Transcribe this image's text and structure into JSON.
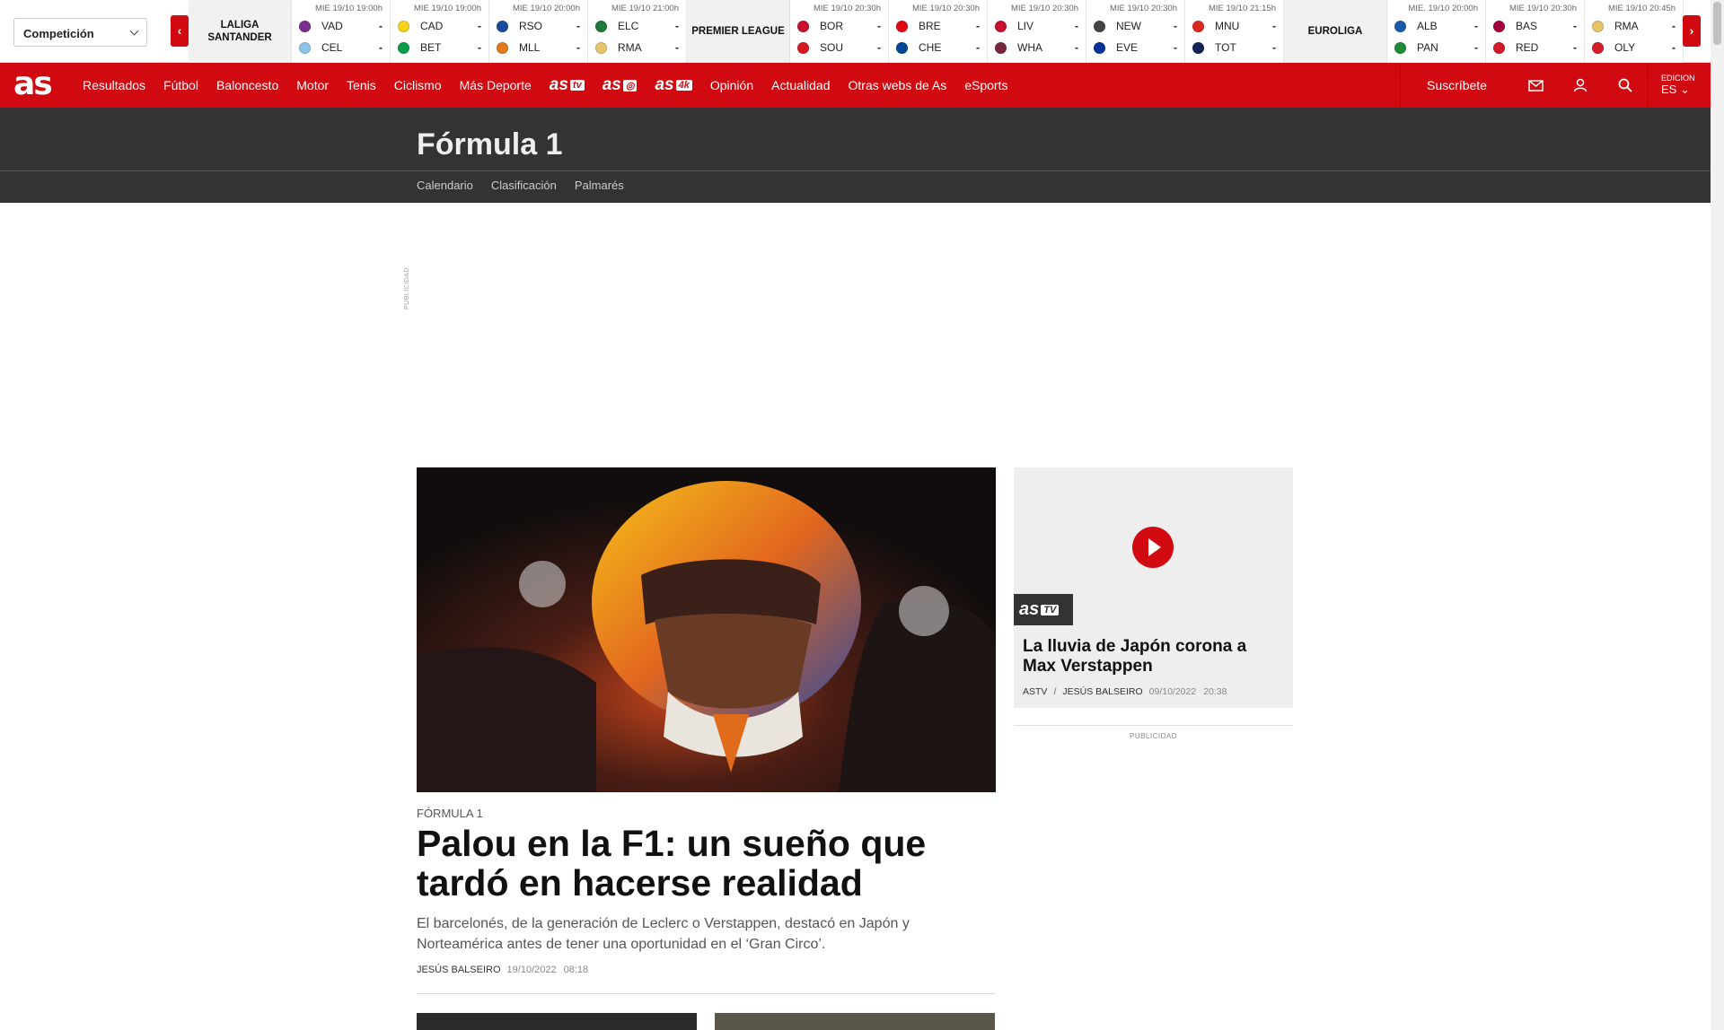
{
  "scores": {
    "competition_select": "Competición",
    "groups": [
      {
        "league": "LALIGA SANTANDER",
        "matches": [
          {
            "time": "MIE 19/10 19:00h",
            "home": "VAD",
            "away": "CEL",
            "home_score": "-",
            "away_score": "-",
            "home_color": "#7a2e8f",
            "away_color": "#8ec4e8"
          },
          {
            "time": "MIE 19/10 19:00h",
            "home": "CAD",
            "away": "BET",
            "home_score": "-",
            "away_score": "-",
            "home_color": "#f2d21b",
            "away_color": "#0a9c4a"
          },
          {
            "time": "MIE 19/10 20:00h",
            "home": "RSO",
            "away": "MLL",
            "home_score": "-",
            "away_score": "-",
            "home_color": "#1a4a9c",
            "away_color": "#e07a1a"
          },
          {
            "time": "MIE 19/10 21:00h",
            "home": "ELC",
            "away": "RMA",
            "home_score": "-",
            "away_score": "-",
            "home_color": "#1e7a3a",
            "away_color": "#e6c46a"
          }
        ]
      },
      {
        "league": "PREMIER LEAGUE",
        "matches": [
          {
            "time": "MIE 19/10 20:30h",
            "home": "BOR",
            "away": "SOU",
            "home_score": "-",
            "away_score": "-",
            "home_color": "#c8102e",
            "away_color": "#d71920"
          },
          {
            "time": "MIE 19/10 20:30h",
            "home": "BRE",
            "away": "CHE",
            "home_score": "-",
            "away_score": "-",
            "home_color": "#e30613",
            "away_color": "#034694"
          },
          {
            "time": "MIE 19/10 20:30h",
            "home": "LIV",
            "away": "WHA",
            "home_score": "-",
            "away_score": "-",
            "home_color": "#c8102e",
            "away_color": "#7a263a"
          },
          {
            "time": "MIE 19/10 20:30h",
            "home": "NEW",
            "away": "EVE",
            "home_score": "-",
            "away_score": "-",
            "home_color": "#444444",
            "away_color": "#003399"
          },
          {
            "time": "MIE 19/10 21:15h",
            "home": "MNU",
            "away": "TOT",
            "home_score": "-",
            "away_score": "-",
            "home_color": "#da291c",
            "away_color": "#132257"
          }
        ]
      },
      {
        "league": "EUROLIGA",
        "matches": [
          {
            "time": "MIE. 19/10 20:00h",
            "home": "ALB",
            "away": "PAN",
            "home_score": "-",
            "away_score": "-",
            "home_color": "#1a5aa8",
            "away_color": "#1f8a3a"
          },
          {
            "time": "MIE 19/10 20:30h",
            "home": "BAS",
            "away": "RED",
            "home_score": "-",
            "away_score": "-",
            "home_color": "#a5003c",
            "away_color": "#d41a2a"
          },
          {
            "time": "MIE 19/10 20:45h",
            "home": "RMA",
            "away": "OLY",
            "home_score": "-",
            "away_score": "-",
            "home_color": "#e6c46a",
            "away_color": "#d11e2a"
          }
        ]
      }
    ]
  },
  "nav": {
    "logo": "as",
    "items": [
      "Resultados",
      "Fútbol",
      "Baloncesto",
      "Motor",
      "Tenis",
      "Ciclismo",
      "Más Deporte"
    ],
    "brands": [
      {
        "main": "as",
        "tag": "tv"
      },
      {
        "main": "as",
        "tag": "◎"
      },
      {
        "main": "as",
        "tag": "4k"
      }
    ],
    "items2": [
      "Opinión",
      "Actualidad",
      "Otras webs de As",
      "eSports"
    ],
    "subscribe": "Suscríbete",
    "edition_label": "EDICION",
    "edition_value": "ES"
  },
  "section": {
    "title": "Fórmula 1",
    "subnav": [
      "Calendario",
      "Clasificación",
      "Palmarés"
    ]
  },
  "ad": {
    "vertical_label": "PUBLICIDAD"
  },
  "article": {
    "category": "FÓRMULA 1",
    "headline": "Palou en la F1: un sueño que tardó en hacerse realidad",
    "dek": "El barcelonés, de la generación de Leclerc o Verstappen, destacó en Japón y Norteamérica antes de tener una oportunidad en el ‘Gran Circo’.",
    "author": "JESÚS BALSEIRO",
    "date": "19/10/2022",
    "time": "08:18"
  },
  "video": {
    "badge_main": "as",
    "badge_tag": "TV",
    "title": "La lluvia de Japón corona a Max Verstappen",
    "source": "ASTV",
    "author": "JESÚS BALSEIRO",
    "date": "09/10/2022",
    "time": "20:38"
  },
  "publicidad": "PUBLICIDAD",
  "colors": {
    "brand_red": "#d10a11",
    "section_bg": "#333333"
  }
}
